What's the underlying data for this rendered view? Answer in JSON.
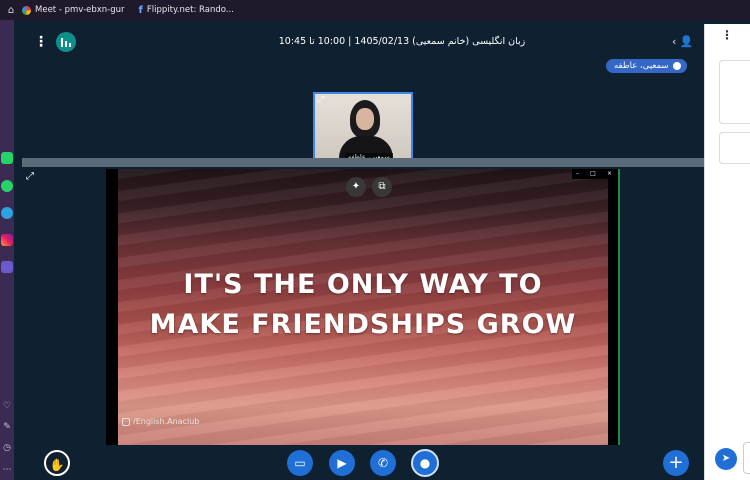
{
  "browser": {
    "bookmarks": [
      {
        "label": "Meet - pmv-ebxn-gur"
      },
      {
        "label": "Flippity.net: Rando..."
      }
    ]
  },
  "meeting": {
    "title": "زبان انگلیسی (خانم سمعیی) 1405/02/13 | 10:00 تا 10:45",
    "talking_indicator": "سمعیی، عاطفه",
    "webcam_name": "سمعیی، عاطفه"
  },
  "screenshare": {
    "caption_line1": "IT'S THE ONLY WAY TO",
    "caption_line2": "MAKE FRIENDSHIPS GROW",
    "watermark": "/English.Anaclub"
  },
  "colors": {
    "app_background": "#0f2130",
    "accent_blue": "#1f6fd6",
    "sidebar_purple": "#3b2a52",
    "stats_teal": "#0f8f8a"
  },
  "icons": {
    "raise_hand": "hand-icon",
    "share_screen": "desktop-icon",
    "camera": "video-camera-icon",
    "leave": "phone-icon",
    "microphone": "microphone-icon",
    "actions": "plus-icon",
    "send": "paper-plane-icon"
  }
}
